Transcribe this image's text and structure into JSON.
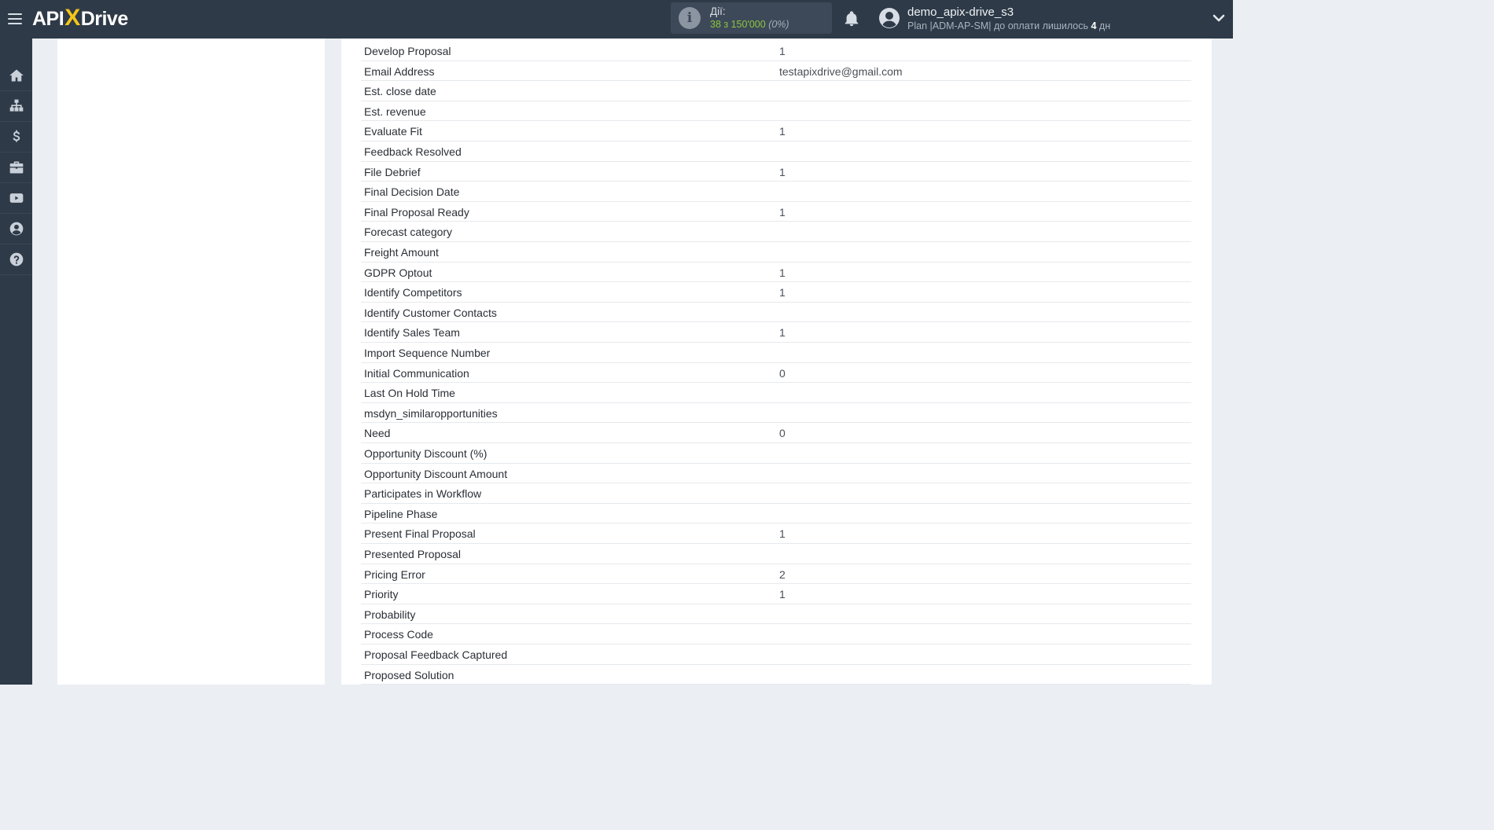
{
  "header": {
    "logo": {
      "api": "API",
      "x": "X",
      "drive": "Drive"
    },
    "actions": {
      "label": "Дії:",
      "used": "38",
      "of_total": "з 150'000",
      "percent": "(0%)"
    },
    "user": {
      "name": "demo_apix-drive_s3",
      "plan_prefix": "Plan |ADM-AP-SM| до оплати лишилось ",
      "days_left": "4",
      "days_suffix": " дн"
    }
  },
  "sidebar": {
    "items": [
      {
        "icon": "home-icon"
      },
      {
        "icon": "sitemap-icon"
      },
      {
        "icon": "dollar-icon"
      },
      {
        "icon": "briefcase-icon"
      },
      {
        "icon": "video-icon"
      },
      {
        "icon": "user-circle-icon"
      },
      {
        "icon": "help-icon"
      }
    ]
  },
  "fields": [
    {
      "key": "Develop Proposal",
      "value": "1"
    },
    {
      "key": "Email Address",
      "value": "testapixdrive@gmail.com"
    },
    {
      "key": "Est. close date",
      "value": ""
    },
    {
      "key": "Est. revenue",
      "value": ""
    },
    {
      "key": "Evaluate Fit",
      "value": "1"
    },
    {
      "key": "Feedback Resolved",
      "value": ""
    },
    {
      "key": "File Debrief",
      "value": "1"
    },
    {
      "key": "Final Decision Date",
      "value": ""
    },
    {
      "key": "Final Proposal Ready",
      "value": "1"
    },
    {
      "key": "Forecast category",
      "value": ""
    },
    {
      "key": "Freight Amount",
      "value": ""
    },
    {
      "key": "GDPR Optout",
      "value": "1"
    },
    {
      "key": "Identify Competitors",
      "value": "1"
    },
    {
      "key": "Identify Customer Contacts",
      "value": ""
    },
    {
      "key": "Identify Sales Team",
      "value": "1"
    },
    {
      "key": "Import Sequence Number",
      "value": ""
    },
    {
      "key": "Initial Communication",
      "value": "0"
    },
    {
      "key": "Last On Hold Time",
      "value": ""
    },
    {
      "key": "msdyn_similaropportunities",
      "value": ""
    },
    {
      "key": "Need",
      "value": "0"
    },
    {
      "key": "Opportunity Discount (%)",
      "value": ""
    },
    {
      "key": "Opportunity Discount Amount",
      "value": ""
    },
    {
      "key": "Participates in Workflow",
      "value": ""
    },
    {
      "key": "Pipeline Phase",
      "value": ""
    },
    {
      "key": "Present Final Proposal",
      "value": "1"
    },
    {
      "key": "Presented Proposal",
      "value": ""
    },
    {
      "key": "Pricing Error",
      "value": "2"
    },
    {
      "key": "Priority",
      "value": "1"
    },
    {
      "key": "Probability",
      "value": ""
    },
    {
      "key": "Process Code",
      "value": ""
    },
    {
      "key": "Proposal Feedback Captured",
      "value": ""
    },
    {
      "key": "Proposed Solution",
      "value": ""
    }
  ]
}
